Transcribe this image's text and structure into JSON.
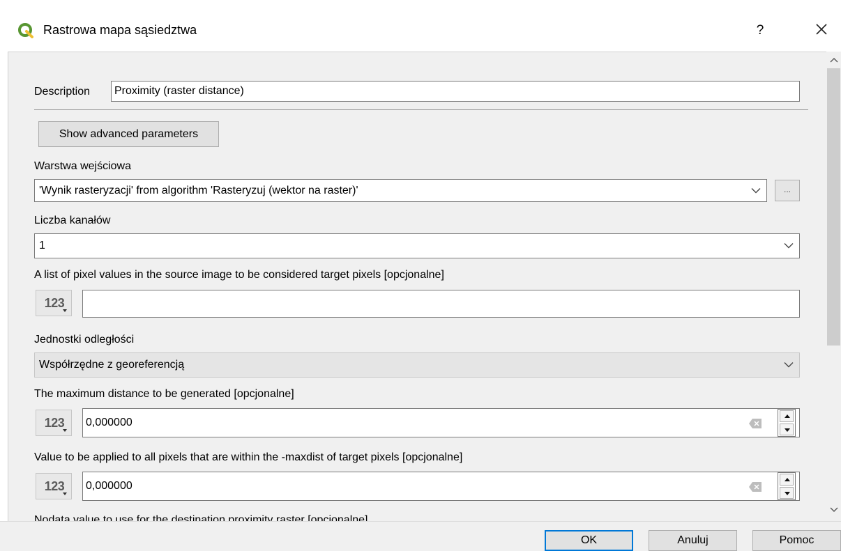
{
  "dialog": {
    "title": "Rastrowa mapa sąsiedztwa",
    "help_label": "?",
    "app_icon": "qgis-logo-icon",
    "close_icon": "close-icon"
  },
  "form": {
    "description_label": "Description",
    "description_value": "Proximity (raster distance)",
    "advanced_button": "Show advanced parameters",
    "input_layer_label": "Warstwa wejściowa",
    "input_layer_value": "'Wynik rasteryzacji' from algorithm 'Rasteryzuj (wektor na raster)'",
    "browse_button": "...",
    "band_label": "Liczba kanałów",
    "band_value": "1",
    "target_values_label": "A list of pixel values in the source image to be considered target pixels [opcjonalne]",
    "target_values_value": "",
    "units_label": "Jednostki odległości",
    "units_value": "Współrzędne z georeferencją",
    "max_distance_label": "The maximum distance to be generated [opcjonalne]",
    "max_distance_value": "0,000000",
    "replace_label": "Value to be applied to all pixels that are within the -maxdist of target pixels [opcjonalne]",
    "replace_value": "0,000000",
    "nodata_label": "Nodata value to use for the destination proximity raster [opcjonalne]",
    "expression_button_label": "123"
  },
  "footer": {
    "ok": "OK",
    "cancel": "Anuluj",
    "help": "Pomoc"
  },
  "colors": {
    "accent": "#0078d7",
    "panel_bg": "#f0f0f0",
    "qgis_green": "#589632",
    "qgis_yellow": "#eebf31"
  }
}
